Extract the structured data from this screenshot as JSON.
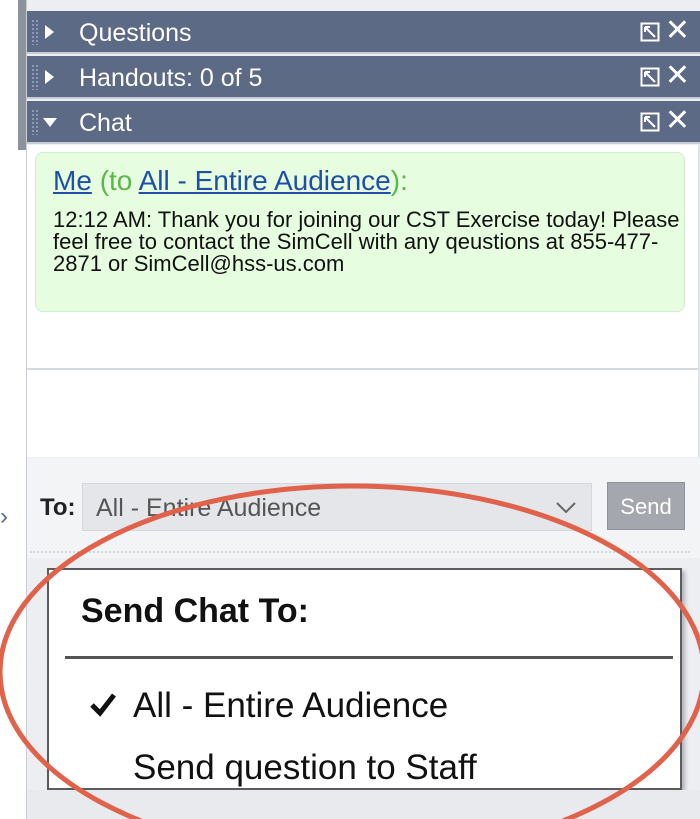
{
  "panel_headers": [
    {
      "label": "Questions",
      "state": "collapsed"
    },
    {
      "label": "Handouts: 0 of 5",
      "state": "collapsed"
    },
    {
      "label": "Chat",
      "state": "expanded"
    }
  ],
  "chat": {
    "message": {
      "sender": "Me",
      "prefix": "(to ",
      "recipient": "All - Entire Audience",
      "suffix": "):",
      "text": "12:12 AM: Thank you for joining our CST Exercise today! Please feel free to contact the SimCell with any qeustions at 855-477-2871 or SimCell@hss-us.com"
    }
  },
  "to_row": {
    "label": "To:",
    "selected": "All - Entire Audience",
    "send_label": "Send"
  },
  "popup": {
    "title": "Send Chat To:",
    "options": [
      {
        "label": "All - Entire Audience",
        "checked": true
      },
      {
        "label": "Send question to Staff",
        "checked": false
      }
    ]
  },
  "colors": {
    "header_bg": "#5c6a86",
    "message_bg": "#e6fde0",
    "link": "#1f4fa8",
    "sender_paren": "#5db64a",
    "annotation": "#e0624a"
  },
  "icons": [
    "expand-arrow-icon",
    "collapse-arrow-icon",
    "undock-icon",
    "close-icon",
    "chevron-down-icon",
    "checkmark-icon",
    "pointer-arrow-icon"
  ]
}
